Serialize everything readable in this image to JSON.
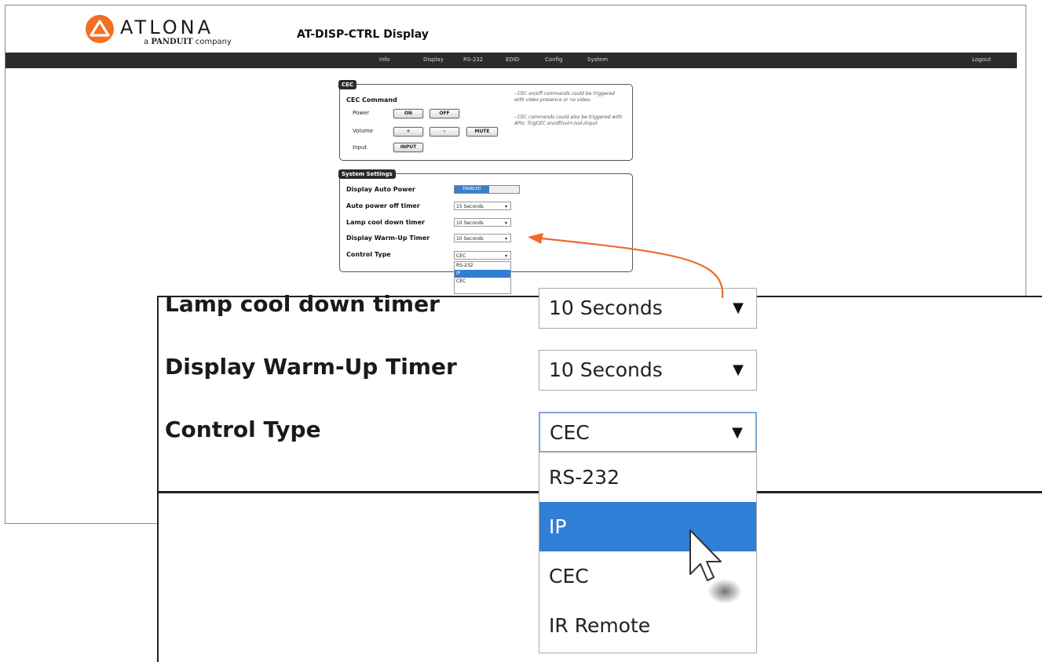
{
  "brand": {
    "name": "ATLONA",
    "tagline_prefix": "a",
    "tagline_brand": "PANDUIT",
    "tagline_suffix": "company",
    "logo_color": "#f36f21"
  },
  "page_title": "AT-DISP-CTRL  Display",
  "nav": {
    "items": [
      "Info",
      "Display",
      "RS-232",
      "EDID",
      "Config",
      "System"
    ],
    "logout": "Logout"
  },
  "cec": {
    "tab": "CEC",
    "heading": "CEC Command",
    "power_label": "Power",
    "on_button": "ON",
    "off_button": "OFF",
    "volume_label": "Volume",
    "vol_up_button": "+",
    "vol_down_button": "-",
    "mute_button": "MUTE",
    "input_label": "Input",
    "input_button": "INPUT",
    "note1_line1": "- CEC on/off commands could be triggered",
    "note1_line2": "with video presence or no video.",
    "note2_line1": "- CEC commands could also be triggered with",
    "note2_line2": "APIs: TrigCEC on/off/vol+/vol-/input"
  },
  "system": {
    "tab": "System Settings",
    "auto_power_label": "Display Auto Power",
    "auto_power_state": "ENABLED",
    "auto_off_label": "Auto power off timer",
    "auto_off_value": "15 Seconds",
    "cooldown_label": "Lamp cool down timer",
    "cooldown_value": "10 Seconds",
    "warmup_label": "Display Warm-Up Timer",
    "warmup_value": "10 Seconds",
    "control_label": "Control Type",
    "control_value": "CEC",
    "small_options": [
      "RS-232",
      "IP",
      "CEC"
    ]
  },
  "zoom": {
    "cooldown_label": "Lamp cool down timer",
    "cooldown_value": "10 Seconds",
    "warmup_label": "Display Warm-Up Timer",
    "warmup_value": "10 Seconds",
    "control_label": "Control Type",
    "control_value": "CEC",
    "options": [
      "RS-232",
      "IP",
      "CEC",
      "IR Remote"
    ],
    "highlighted_option": "IP"
  },
  "colors": {
    "accent_orange": "#f06a2a",
    "highlight_blue": "#2f7fd6",
    "navbar": "#2b2b2b"
  }
}
